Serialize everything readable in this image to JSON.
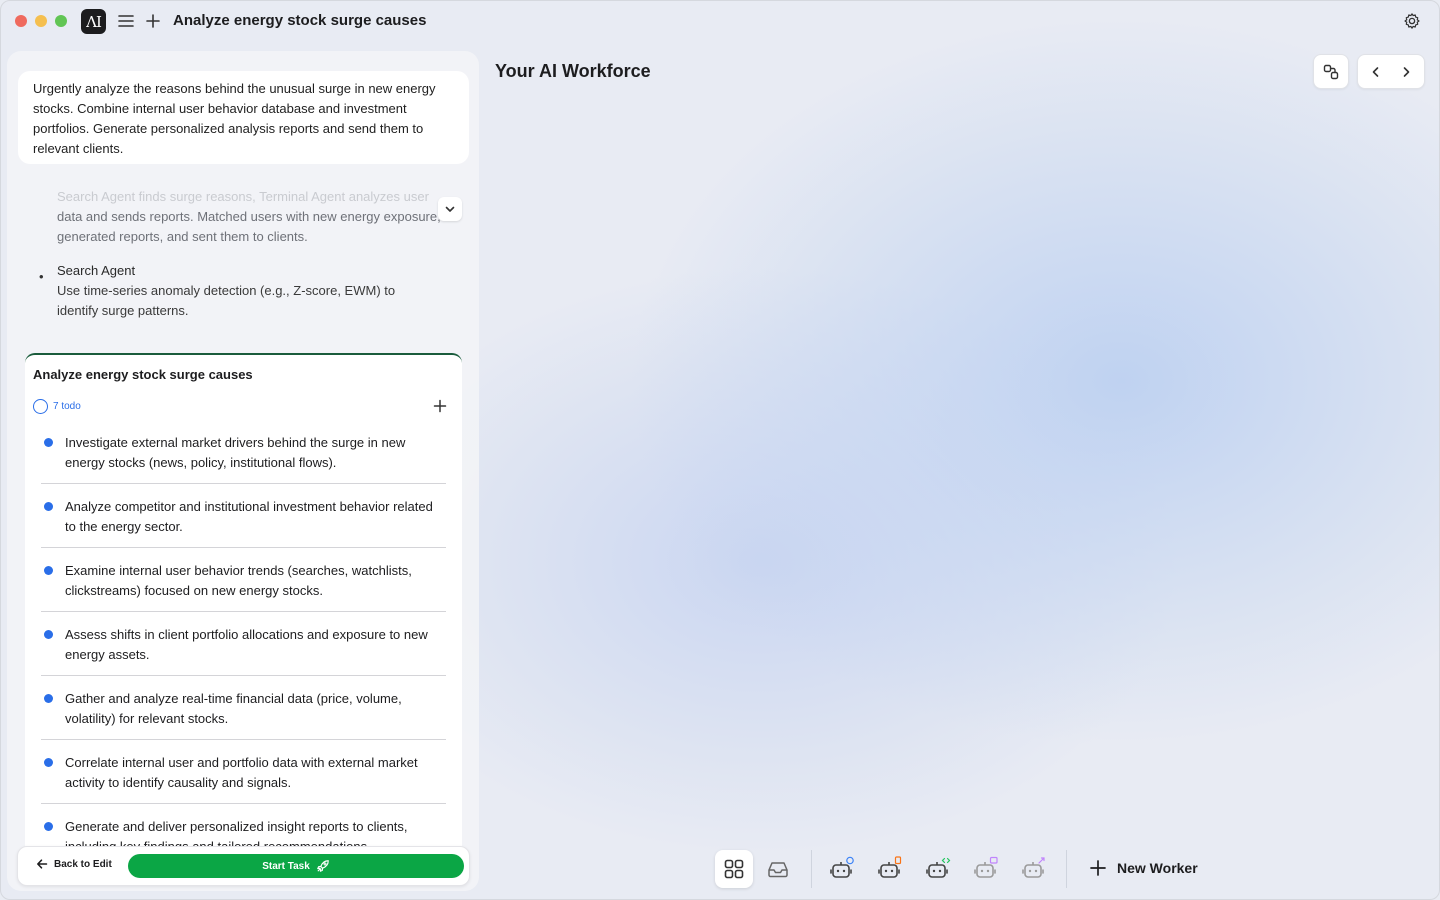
{
  "window": {
    "title": "Analyze energy stock surge causes",
    "traffic_colors": [
      "#ef6a5e",
      "#f5bf4f",
      "#61c554"
    ],
    "logo_text": "ΛI"
  },
  "left": {
    "prompt": "Urgently analyze the reasons behind the unusual surge in new energy stocks. Combine internal user behavior database and investment portfolios. Generate personalized analysis reports and send them to relevant clients.",
    "summary_faded": "Search Agent finds surge reasons, Terminal Agent analyzes user",
    "summary_rest": "data and sends reports. Matched users with new energy exposure, generated reports, and sent them to clients.",
    "agent_name": "Search Agent",
    "agent_desc": "Use time-series anomaly detection (e.g., Z-score, EWM) to identify surge patterns.",
    "task_card": {
      "title": "Analyze energy stock surge causes",
      "todo_count": "7 todo",
      "items": [
        "Investigate external market drivers behind the surge in new energy stocks (news, policy, institutional flows).",
        "Analyze competitor and institutional investment behavior related to the energy sector.",
        "Examine internal user behavior trends (searches, watchlists, clickstreams) focused on new energy stocks.",
        "Assess shifts in client portfolio allocations and exposure to new energy assets.",
        "Gather and analyze real-time financial data (price, volume, volatility) for relevant stocks.",
        "Correlate internal user and portfolio data with external market activity to identify causality and signals.",
        "Generate and deliver personalized insight reports to clients, including key findings and tailored recommendations."
      ]
    },
    "back_label": "Back to Edit",
    "start_label": "Start Task"
  },
  "right": {
    "title": "Your AI Workforce",
    "new_worker_label": "New Worker",
    "worker_badge_colors": [
      "#3b82f6",
      "#f97316",
      "#22c55e",
      "#c084fc",
      "#c084fc"
    ]
  },
  "colors": {
    "accent_blue": "#2a6ee8",
    "start_green": "#0ba645",
    "card_border": "#1a5c3c"
  }
}
